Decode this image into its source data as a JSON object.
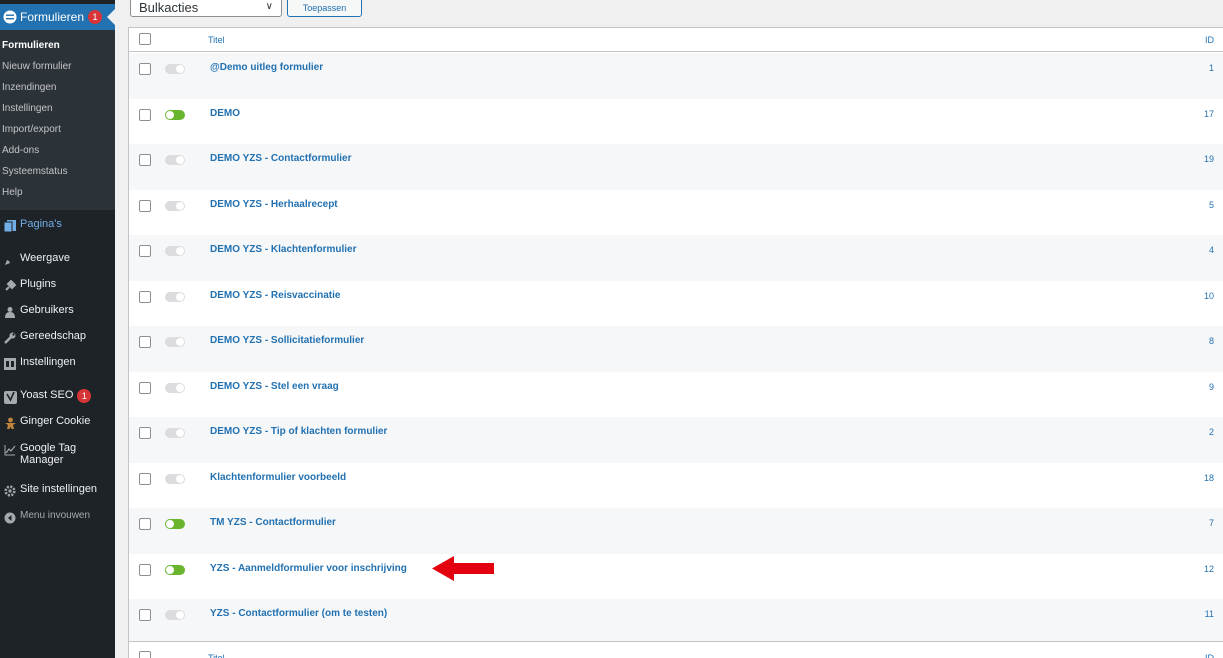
{
  "sidebar": {
    "current": {
      "label": "Formulieren",
      "badge": "1",
      "icon": "forms-icon"
    },
    "submenu": [
      {
        "label": "Formulieren",
        "active": true
      },
      {
        "label": "Nieuw formulier"
      },
      {
        "label": "Inzendingen"
      },
      {
        "label": "Instellingen"
      },
      {
        "label": "Import/export"
      },
      {
        "label": "Add-ons"
      },
      {
        "label": "Systeemstatus"
      },
      {
        "label": "Help"
      }
    ],
    "items": [
      {
        "label": "Pagina's",
        "icon": "pages-icon"
      },
      {
        "label": "Weergave",
        "icon": "appearance-icon"
      },
      {
        "label": "Plugins",
        "icon": "plugins-icon"
      },
      {
        "label": "Gebruikers",
        "icon": "users-icon"
      },
      {
        "label": "Gereedschap",
        "icon": "tools-icon"
      },
      {
        "label": "Instellingen",
        "icon": "settings-icon"
      },
      {
        "label": "Yoast SEO",
        "icon": "yoast-icon",
        "badge": "1"
      },
      {
        "label": "Ginger Cookie",
        "icon": "ginger-cookie-icon"
      },
      {
        "label": "Google Tag Manager",
        "icon": "chart-line-icon"
      },
      {
        "label": "Site instellingen",
        "icon": "gear-icon"
      },
      {
        "label": "Menu invouwen",
        "icon": "collapse-icon"
      }
    ]
  },
  "toolbar": {
    "bulk_actions": "Bulkacties",
    "apply": "Toepassen"
  },
  "table": {
    "col_title": "Titel",
    "col_id": "ID",
    "rows": [
      {
        "title": "@Demo uitleg formulier",
        "id": "1",
        "active": false
      },
      {
        "title": "DEMO",
        "id": "17",
        "active": true
      },
      {
        "title": "DEMO YZS - Contactformulier",
        "id": "19",
        "active": false
      },
      {
        "title": "DEMO YZS - Herhaalrecept",
        "id": "5",
        "active": false
      },
      {
        "title": "DEMO YZS - Klachtenformulier",
        "id": "4",
        "active": false
      },
      {
        "title": "DEMO YZS - Reisvaccinatie",
        "id": "10",
        "active": false
      },
      {
        "title": "DEMO YZS - Sollicitatieformulier",
        "id": "8",
        "active": false
      },
      {
        "title": "DEMO YZS - Stel een vraag",
        "id": "9",
        "active": false
      },
      {
        "title": "DEMO YZS - Tip of klachten formulier",
        "id": "2",
        "active": false
      },
      {
        "title": "Klachtenformulier voorbeeld",
        "id": "18",
        "active": false
      },
      {
        "title": "TM YZS - Contactformulier",
        "id": "7",
        "active": true
      },
      {
        "title": "YZS - Aanmeldformulier voor inschrijving",
        "id": "12",
        "active": true
      },
      {
        "title": "YZS - Contactformulier (om te testen)",
        "id": "11",
        "active": false
      }
    ]
  },
  "colors": {
    "accent": "#2271b1",
    "sidebar": "#1d2327",
    "toggle_on": "#69b52e",
    "arrow": "#e3000f"
  }
}
